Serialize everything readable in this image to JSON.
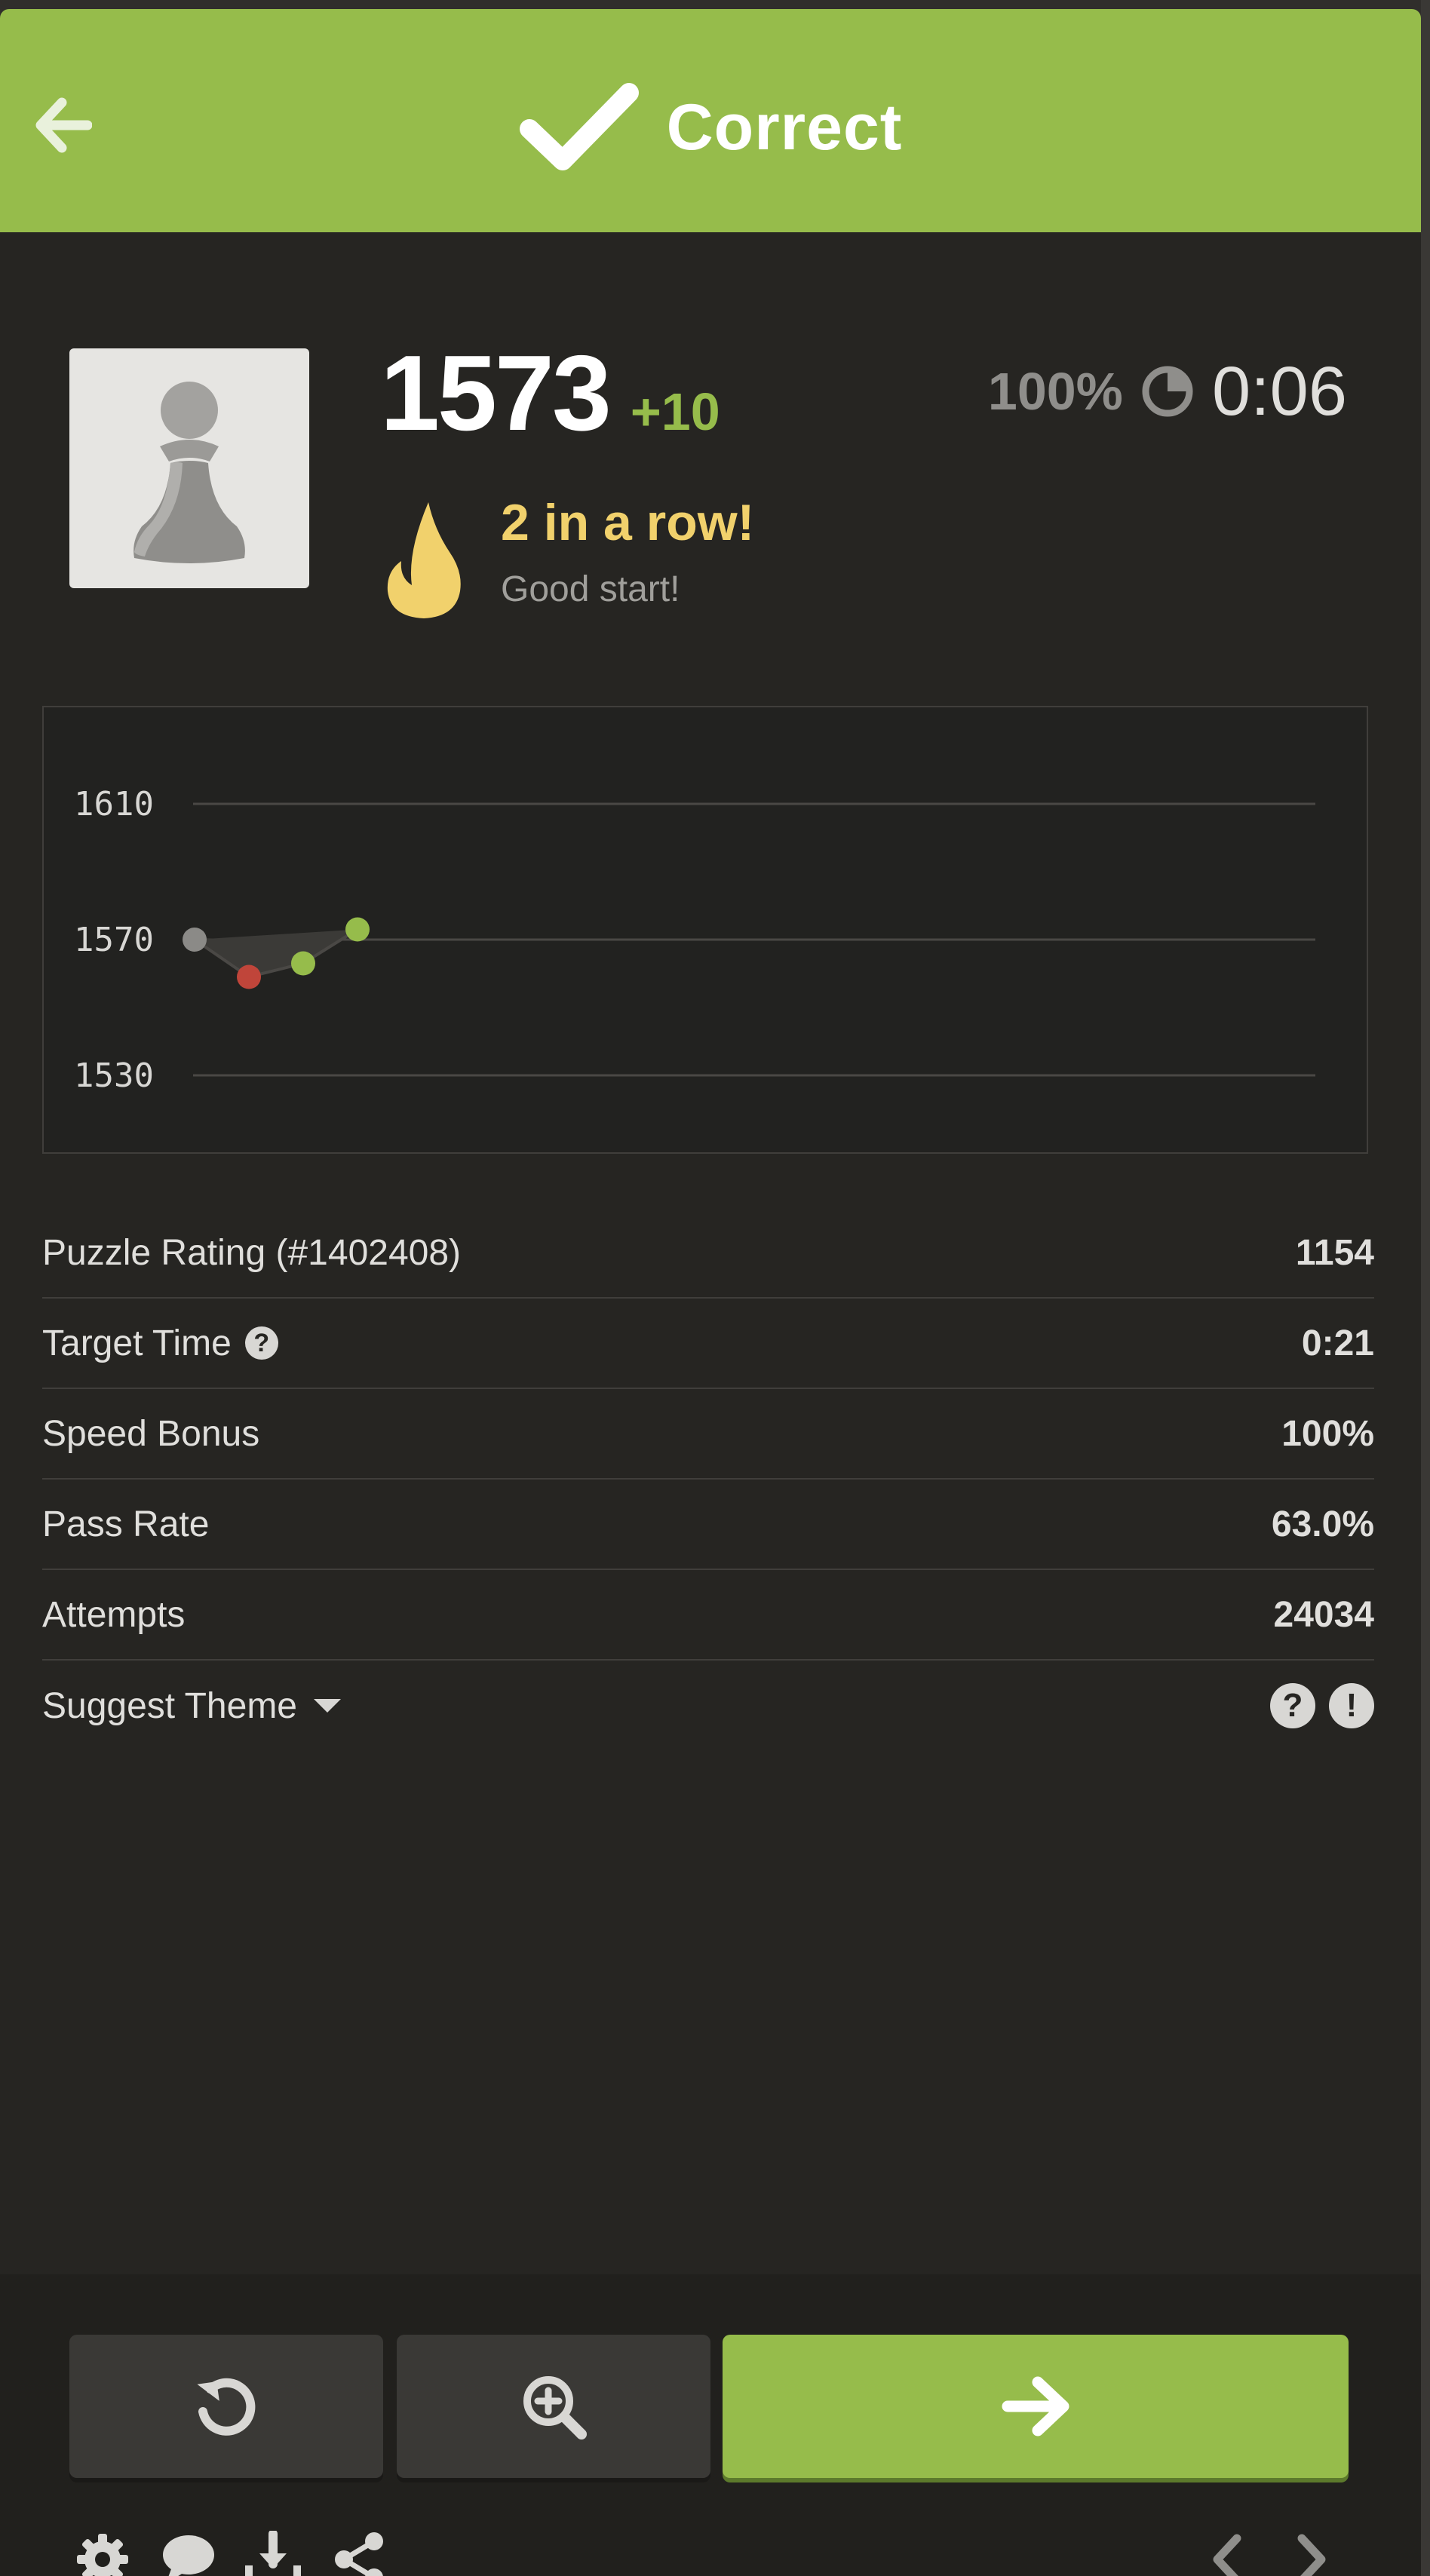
{
  "header": {
    "title": "Correct",
    "back_icon": "arrow-left-icon",
    "check_icon": "checkmark-icon",
    "background": "#96bc4b"
  },
  "result": {
    "rating": "1573",
    "rating_change": "+10",
    "speed_bonus": "100%",
    "time": "0:06",
    "streak_title": "2 in a row!",
    "streak_subtitle": "Good start!",
    "avatar_icon": "pawn-icon",
    "flame_icon": "flame-icon",
    "clock_icon": "pie-clock-icon"
  },
  "chart_data": {
    "type": "line",
    "x": [
      1,
      2,
      3,
      4
    ],
    "values": [
      1570,
      1559,
      1563,
      1573
    ],
    "point_colors": [
      "#8b8a87",
      "#c0453a",
      "#96bc4b",
      "#96bc4b"
    ],
    "yticks": [
      "1610",
      "1570",
      "1530"
    ],
    "ylim": [
      1530,
      1610
    ],
    "grid": true
  },
  "stats": {
    "puzzle_rating_label": "Puzzle Rating (#1402408)",
    "puzzle_rating_value": "1154",
    "target_time_label": "Target Time",
    "target_time_value": "0:21",
    "speed_bonus_label": "Speed Bonus",
    "speed_bonus_value": "100%",
    "pass_rate_label": "Pass Rate",
    "pass_rate_value": "63.0%",
    "attempts_label": "Attempts",
    "attempts_value": "24034",
    "suggest_theme_label": "Suggest Theme",
    "help_glyph": "?",
    "report_glyph": "!"
  },
  "actions": {
    "retry_icon": "retry-icon",
    "analyze_icon": "magnify-plus-icon",
    "next_icon": "arrow-right-icon",
    "tools": [
      "gear-icon",
      "chat-icon",
      "download-icon",
      "share-icon"
    ],
    "nav": [
      "chevron-left-icon",
      "chevron-right-icon"
    ]
  }
}
